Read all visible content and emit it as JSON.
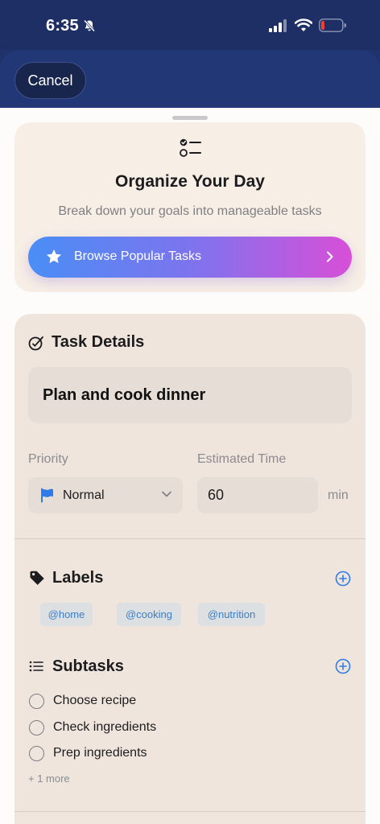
{
  "status_bar": {
    "time": "6:35"
  },
  "header": {
    "cancel_label": "Cancel"
  },
  "intro": {
    "title": "Organize Your Day",
    "subtitle": "Break down your goals into manageable tasks",
    "browse_label": "Browse Popular Tasks"
  },
  "task_details": {
    "title": "Task Details",
    "task_name": "Plan and cook dinner",
    "priority_label": "Priority",
    "priority_value": "Normal",
    "estimated_time_label": "Estimated Time",
    "estimated_time_value": "60",
    "estimated_time_unit": "min"
  },
  "labels": {
    "title": "Labels",
    "items": [
      "@home",
      "@cooking",
      "@nutrition"
    ]
  },
  "subtasks": {
    "title": "Subtasks",
    "items": [
      "Choose recipe",
      "Check ingredients",
      "Prep ingredients"
    ],
    "more": "+ 1 more"
  },
  "colors": {
    "header_bg": "#1f3269",
    "accent_blue": "#3b7ec6",
    "gradient_start": "#4a8ef6",
    "gradient_end": "#d84fd8",
    "card_bg": "#efe5dd"
  },
  "icons": [
    "mute-bell-icon",
    "signal-icon",
    "wifi-icon",
    "battery-icon",
    "checklist-icon",
    "star-icon",
    "chevron-right-icon",
    "task-edit-icon",
    "flag-icon",
    "chevron-down-icon",
    "tag-icon",
    "add-circle-icon",
    "list-icon"
  ]
}
